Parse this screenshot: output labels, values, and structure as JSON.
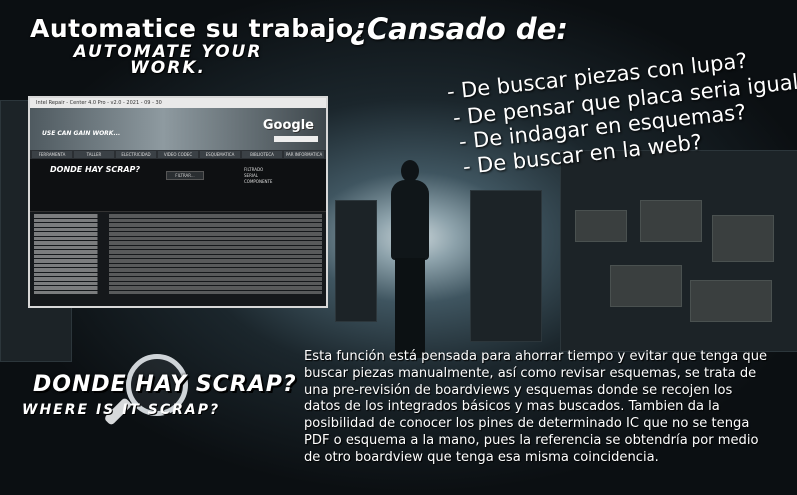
{
  "headline": {
    "es": "Automatice su trabajo.",
    "en": "AUTOMATE YOUR WORK."
  },
  "questions": {
    "title": "¿Cansado de:",
    "items": [
      "- De buscar piezas con lupa?",
      "- De pensar que placa seria igual?",
      "- De indagar en esquemas?",
      "- De buscar en la web?"
    ]
  },
  "app_preview": {
    "window_title": "Intel Repair - Center 4.0 Pro - v2.0 - 2021 - 09 - 30",
    "brand": "Google",
    "banner_logo": "USE CAN GAIN WORK...",
    "toolbar": [
      "FERRAMENTA",
      "TALLER",
      "ELECTRICIDAD",
      "VIDEO CODEC",
      "ESQUEMATICA",
      "BIBLIOTECA",
      "PAR INFORMATICA"
    ],
    "panel_title": "DONDE HAY SCRAP?",
    "filter_label": "FILTRAR...",
    "radio_options": [
      "FILTRADO",
      "SERIAL",
      "COMPONENTE"
    ]
  },
  "logo": {
    "name": "DONDE HAY SCRAP?",
    "subtitle": "WHERE IS IT SCRAP?"
  },
  "description": {
    "lines": [
      "Esta función está pensada para ahorrar tiempo y evitar que tenga que",
      "buscar piezas manualmente, así como revisar esquemas, se trata de",
      "una pre-revisión de boardviews y esquemas donde se recojen los",
      "datos de los integrados básicos y mas buscados. Tambien da la",
      "posibilidad de conocer los pines de determinado IC que no se tenga",
      "PDF o esquema a la mano, pues la referencia se obtendría por medio",
      "de otro boardview que tenga esa misma coincidencia."
    ]
  }
}
